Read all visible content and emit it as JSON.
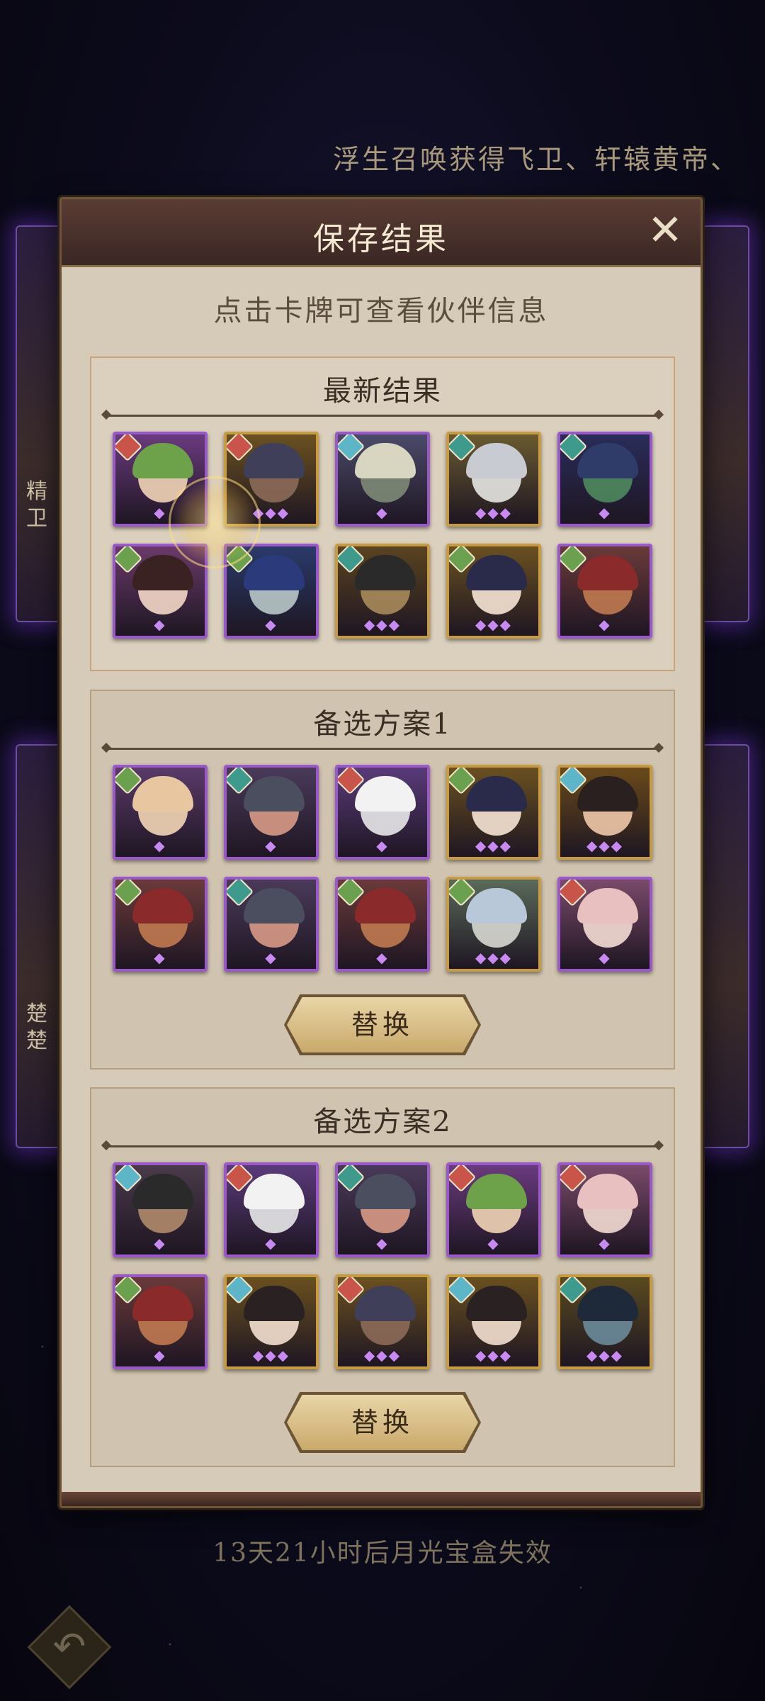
{
  "marquee": "浮生召唤获得飞卫、轩辕黄帝、",
  "side_cards": {
    "left_top_name": "精卫",
    "left_bottom_name": "楚楚"
  },
  "modal": {
    "title": "保存结果",
    "close_icon": "close-icon",
    "hint": "点击卡牌可查看伙伴信息"
  },
  "sections": {
    "latest": {
      "title": "最新结果",
      "cards": [
        {
          "frame": "purple",
          "element": "fire",
          "stars": 1,
          "hair": "#6ea24a",
          "face": "#f1d4b5",
          "bg": "#6a3a7e"
        },
        {
          "frame": "gold",
          "element": "fire",
          "stars": 3,
          "hair": "#3f3f5a",
          "face": "#8c6a58",
          "bg": "#6b5120"
        },
        {
          "frame": "purple",
          "element": "water",
          "stars": 1,
          "hair": "#d8d6c0",
          "face": "#7d8a76",
          "bg": "#4b4a6a"
        },
        {
          "frame": "gold",
          "element": "wind",
          "stars": 3,
          "hair": "#c8ccd2",
          "face": "#e6e6e2",
          "bg": "#6a5a30"
        },
        {
          "frame": "purple",
          "element": "wind",
          "stars": 1,
          "hair": "#2f3c6a",
          "face": "#4f8a5e",
          "bg": "#2a2c5a"
        },
        {
          "frame": "purple",
          "element": "wood",
          "stars": 1,
          "hair": "#3a2222",
          "face": "#f3d8c6",
          "bg": "#6a3a6a"
        },
        {
          "frame": "purple",
          "element": "wood",
          "stars": 1,
          "hair": "#2a3a7a",
          "face": "#b9c8c8",
          "bg": "#2a3a6a"
        },
        {
          "frame": "gold",
          "element": "wind",
          "stars": 3,
          "hair": "#2a2a2a",
          "face": "#a88a5a",
          "bg": "#5a4320"
        },
        {
          "frame": "gold",
          "element": "wood",
          "stars": 3,
          "hair": "#2a2a4a",
          "face": "#f6e4d4",
          "bg": "#6a5020"
        },
        {
          "frame": "purple",
          "element": "wood",
          "stars": 1,
          "hair": "#8a2a2a",
          "face": "#c07a50",
          "bg": "#6a3a3a"
        }
      ]
    },
    "alt1": {
      "title": "备选方案1",
      "button_label": "替换",
      "cards": [
        {
          "frame": "purple",
          "element": "wood",
          "stars": 1,
          "hair": "#e8c6a0",
          "face": "#f2d6b6",
          "bg": "#5a3a6a"
        },
        {
          "frame": "purple",
          "element": "wind",
          "stars": 1,
          "hair": "#4a4e5e",
          "face": "#d89a86",
          "bg": "#4a3a5a"
        },
        {
          "frame": "purple",
          "element": "fire",
          "stars": 1,
          "hair": "#f2f2f2",
          "face": "#e8e8e8",
          "bg": "#5a3a7a"
        },
        {
          "frame": "gold",
          "element": "wood",
          "stars": 3,
          "hair": "#2a2a4a",
          "face": "#f6e4d4",
          "bg": "#6a5020"
        },
        {
          "frame": "gold",
          "element": "water",
          "stars": 3,
          "hair": "#2a2020",
          "face": "#f0c8a8",
          "bg": "#6a4a1a"
        },
        {
          "frame": "purple",
          "element": "wood",
          "stars": 1,
          "hair": "#8a2a2a",
          "face": "#c07a50",
          "bg": "#6a3a3a"
        },
        {
          "frame": "purple",
          "element": "wind",
          "stars": 1,
          "hair": "#4a4e5e",
          "face": "#d89a86",
          "bg": "#4a3a5a"
        },
        {
          "frame": "purple",
          "element": "wood",
          "stars": 1,
          "hair": "#8a2a2a",
          "face": "#c07a50",
          "bg": "#6a3a3a"
        },
        {
          "frame": "gold",
          "element": "wood",
          "stars": 3,
          "hair": "#b8c8d8",
          "face": "#d8d8d2",
          "bg": "#5a6a5a"
        },
        {
          "frame": "purple",
          "element": "fire",
          "stars": 1,
          "hair": "#e8c0c0",
          "face": "#f4dcd4",
          "bg": "#7a4a6a"
        }
      ]
    },
    "alt2": {
      "title": "备选方案2",
      "button_label": "替换",
      "cards": [
        {
          "frame": "purple",
          "element": "water",
          "stars": 1,
          "hair": "#2a2a2a",
          "face": "#b08a6a",
          "bg": "#4a3a4a"
        },
        {
          "frame": "purple",
          "element": "fire",
          "stars": 1,
          "hair": "#f2f2f2",
          "face": "#e8e8e8",
          "bg": "#5a3a7a"
        },
        {
          "frame": "purple",
          "element": "wind",
          "stars": 1,
          "hair": "#4a4e5e",
          "face": "#d89a86",
          "bg": "#4a3a5a"
        },
        {
          "frame": "purple",
          "element": "fire",
          "stars": 1,
          "hair": "#6ea24a",
          "face": "#f1d4b5",
          "bg": "#6a3a7e"
        },
        {
          "frame": "purple",
          "element": "fire",
          "stars": 1,
          "hair": "#e8c0c0",
          "face": "#f4dcd4",
          "bg": "#7a4a6a"
        },
        {
          "frame": "purple",
          "element": "wood",
          "stars": 1,
          "hair": "#8a2a2a",
          "face": "#c07a50",
          "bg": "#6a3a3a"
        },
        {
          "frame": "gold",
          "element": "water",
          "stars": 3,
          "hair": "#2a2222",
          "face": "#f4e0d0",
          "bg": "#6a5020"
        },
        {
          "frame": "gold",
          "element": "fire",
          "stars": 3,
          "hair": "#3f3f5a",
          "face": "#8c6a58",
          "bg": "#6b5120"
        },
        {
          "frame": "gold",
          "element": "water",
          "stars": 3,
          "hair": "#2a2222",
          "face": "#f4e0d0",
          "bg": "#6a5020"
        },
        {
          "frame": "gold",
          "element": "wind",
          "stars": 3,
          "hair": "#1e2a3a",
          "face": "#6a8a9a",
          "bg": "#5a4a20"
        }
      ]
    }
  },
  "element_colors": {
    "fire": "#c9554a",
    "wind": "#3f9a8e",
    "water": "#5cb6c8",
    "wood": "#6aa04e"
  },
  "frame_colors": {
    "purple": "#9a58c9",
    "gold": "#c79a44"
  },
  "expiry_text": "13天21小时后月光宝盒失效",
  "back_icon": "back-arrow-icon"
}
